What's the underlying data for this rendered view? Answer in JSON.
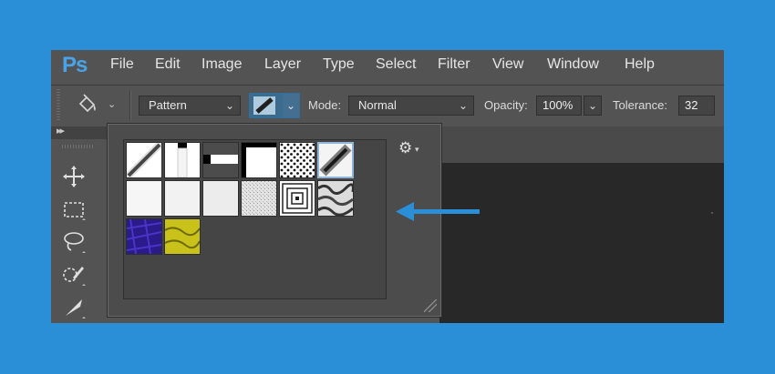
{
  "app": {
    "logo": "Ps"
  },
  "menu": [
    "File",
    "Edit",
    "Image",
    "Layer",
    "Type",
    "Select",
    "Filter",
    "View",
    "Window",
    "Help"
  ],
  "options": {
    "fill_source": "Pattern",
    "mode_label": "Mode:",
    "mode_value": "Normal",
    "opacity_label": "Opacity:",
    "opacity_value": "100%",
    "tolerance_label": "Tolerance:",
    "tolerance_value": "32"
  },
  "patterns": [
    {
      "name": "diagonal-line"
    },
    {
      "name": "vertical-bar"
    },
    {
      "name": "horizontal-bar"
    },
    {
      "name": "corner-frame"
    },
    {
      "name": "dots"
    },
    {
      "name": "diagonal-selected"
    },
    {
      "name": "white-texture-1"
    },
    {
      "name": "white-texture-2"
    },
    {
      "name": "white-texture-3"
    },
    {
      "name": "grain-texture"
    },
    {
      "name": "concentric-squares"
    },
    {
      "name": "crumpled-texture"
    },
    {
      "name": "blue-texture"
    },
    {
      "name": "yellow-texture"
    }
  ],
  "colors": {
    "background": "#2a8fd6",
    "panel": "#535353",
    "accent": "#4aa3e8",
    "annotation": "#2a8fd6"
  }
}
